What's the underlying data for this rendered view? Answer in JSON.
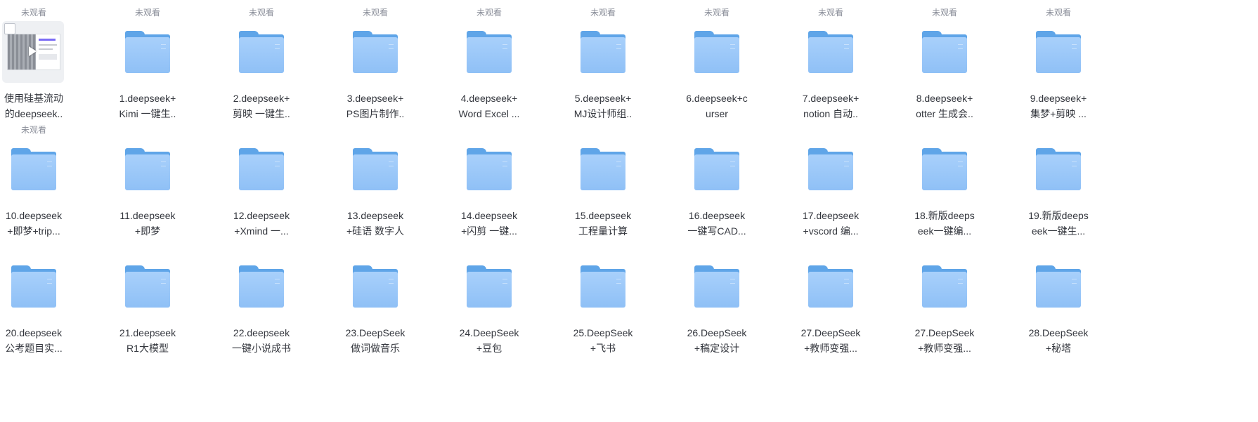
{
  "badge_text": "未观看",
  "colors": {
    "folder_back": "#5fa5e8",
    "folder_front": "#a8d0fb",
    "badge_text": "#8a8e99",
    "name_text": "#33363d"
  },
  "items": [
    {
      "type": "video",
      "badge": true,
      "line1": "使用硅基流动",
      "line2": "的deepseek.."
    },
    {
      "type": "folder",
      "badge": true,
      "line1": "1.deepseek+",
      "line2": "Kimi 一键生.."
    },
    {
      "type": "folder",
      "badge": true,
      "line1": "2.deepseek+",
      "line2": "剪映 一键生.."
    },
    {
      "type": "folder",
      "badge": true,
      "line1": "3.deepseek+",
      "line2": "PS图片制作.."
    },
    {
      "type": "folder",
      "badge": true,
      "line1": "4.deepseek+",
      "line2": "Word Excel ..."
    },
    {
      "type": "folder",
      "badge": true,
      "line1": "5.deepseek+",
      "line2": "MJ设计师组.."
    },
    {
      "type": "folder",
      "badge": true,
      "line1": "6.deepseek+c",
      "line2": "urser"
    },
    {
      "type": "folder",
      "badge": true,
      "line1": "7.deepseek+",
      "line2": "notion 自动.."
    },
    {
      "type": "folder",
      "badge": true,
      "line1": "8.deepseek+",
      "line2": "otter 生成会.."
    },
    {
      "type": "folder",
      "badge": true,
      "line1": "9.deepseek+",
      "line2": "集梦+剪映 ..."
    },
    {
      "type": "folder",
      "badge": true,
      "line1": "10.deepseek",
      "line2": "+即梦+trip..."
    },
    {
      "type": "folder",
      "badge": false,
      "line1": "11.deepseek",
      "line2": "+即梦"
    },
    {
      "type": "folder",
      "badge": false,
      "line1": "12.deepseek",
      "line2": "+Xmind 一..."
    },
    {
      "type": "folder",
      "badge": false,
      "line1": "13.deepseek",
      "line2": "+硅语 数字人"
    },
    {
      "type": "folder",
      "badge": false,
      "line1": "14.deepseek",
      "line2": "+闪剪 一键..."
    },
    {
      "type": "folder",
      "badge": false,
      "line1": "15.deepseek",
      "line2": "工程量计算"
    },
    {
      "type": "folder",
      "badge": false,
      "line1": "16.deepseek",
      "line2": "一键写CAD..."
    },
    {
      "type": "folder",
      "badge": false,
      "line1": "17.deepseek",
      "line2": "+vscord 编..."
    },
    {
      "type": "folder",
      "badge": false,
      "line1": "18.新版deeps",
      "line2": "eek一键编..."
    },
    {
      "type": "folder",
      "badge": false,
      "line1": "19.新版deeps",
      "line2": "eek一键生..."
    },
    {
      "type": "folder",
      "badge": false,
      "line1": "20.deepseek",
      "line2": "公考题目实..."
    },
    {
      "type": "folder",
      "badge": false,
      "line1": "21.deepseek",
      "line2": "R1大模型"
    },
    {
      "type": "folder",
      "badge": false,
      "line1": "22.deepseek",
      "line2": "一键小说成书"
    },
    {
      "type": "folder",
      "badge": false,
      "line1": "23.DeepSeek",
      "line2": "做词做音乐"
    },
    {
      "type": "folder",
      "badge": false,
      "line1": "24.DeepSeek",
      "line2": "+豆包"
    },
    {
      "type": "folder",
      "badge": false,
      "line1": "25.DeepSeek",
      "line2": "+飞书"
    },
    {
      "type": "folder",
      "badge": false,
      "line1": "26.DeepSeek",
      "line2": "+稿定设计"
    },
    {
      "type": "folder",
      "badge": false,
      "line1": "27.DeepSeek",
      "line2": "+教师变强..."
    },
    {
      "type": "folder",
      "badge": false,
      "line1": "27.DeepSeek",
      "line2": "+教师变强..."
    },
    {
      "type": "folder",
      "badge": false,
      "line1": "28.DeepSeek",
      "line2": "+秘塔"
    }
  ]
}
